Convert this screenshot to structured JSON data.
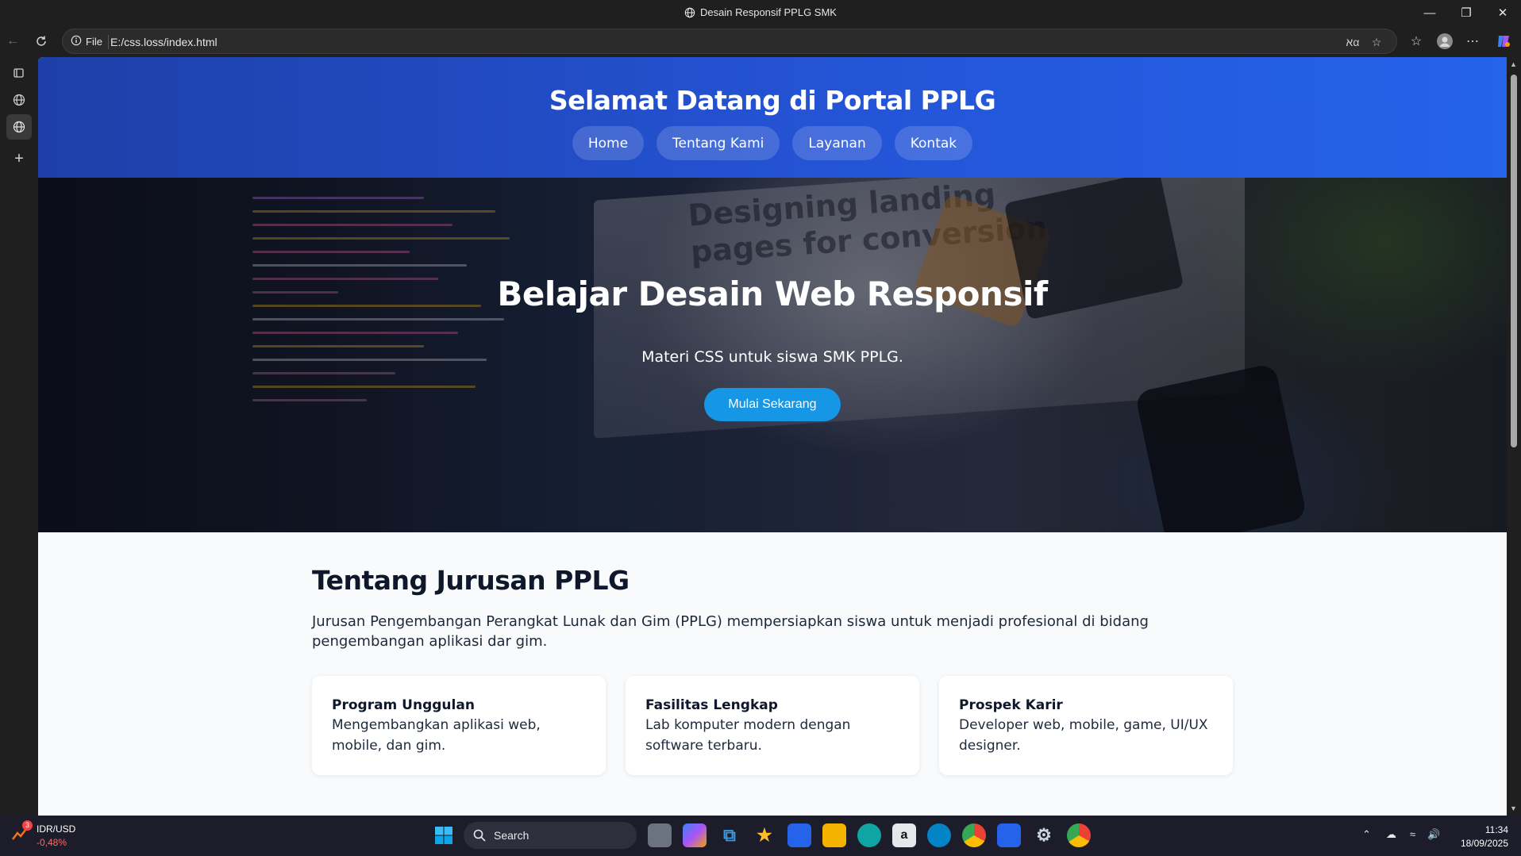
{
  "browser": {
    "window_title": "Desain Responsif PPLG SMK",
    "protocol_label": "File",
    "url": "E:/css.loss/index.html"
  },
  "site": {
    "header_title": "Selamat Datang di Portal PPLG",
    "nav": [
      "Home",
      "Tentang Kami",
      "Layanan",
      "Kontak"
    ],
    "hero": {
      "screen_text_1": "Designing landing",
      "screen_text_2": "pages for conversion",
      "title": "Belajar Desain Web Responsif",
      "subtitle": "Materi CSS untuk siswa SMK PPLG.",
      "cta": "Mulai Sekarang"
    },
    "about": {
      "heading": "Tentang Jurusan PPLG",
      "description": "Jurusan Pengembangan Perangkat Lunak dan Gim (PPLG) mempersiapkan siswa untuk menjadi profesional di bidang pengembangan aplikasi dar gim.",
      "cards": [
        {
          "title": "Program Unggulan",
          "text": "Mengembangkan aplikasi web, mobile, dan gim."
        },
        {
          "title": "Fasilitas Lengkap",
          "text": "Lab komputer modern dengan software terbaru."
        },
        {
          "title": "Prospek Karir",
          "text": "Developer web, mobile, game, UI/UX designer."
        }
      ]
    }
  },
  "taskbar": {
    "ticker_badge": "3",
    "ticker_pair": "IDR/USD",
    "ticker_change": "-0,48%",
    "search_label": "Search",
    "time": "11:34",
    "date": "18/09/2025"
  },
  "colors": {
    "header_gradient_start": "#1e3fa8",
    "header_gradient_end": "#2563eb",
    "cta_button": "#1597e5",
    "page_background": "#f8fafc"
  }
}
